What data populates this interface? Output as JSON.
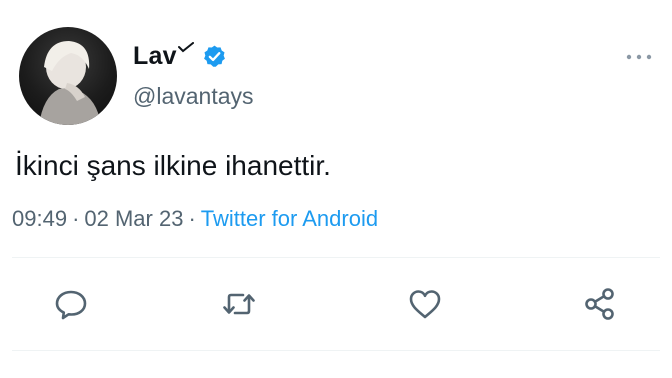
{
  "profile": {
    "display_name": "Lav",
    "name_emoji": "✓",
    "handle": "@lavantays",
    "verified": true,
    "avatar_icon": "profile-photo"
  },
  "tweet": {
    "text": "İkinci şans ilkine ihanettir.",
    "time": "09:49",
    "separator": "·",
    "date": "02 Mar 23",
    "source": "Twitter for Android"
  },
  "actions": [
    {
      "name": "reply",
      "icon": "comment-bubble-icon"
    },
    {
      "name": "retweet",
      "icon": "retweet-arrows-icon"
    },
    {
      "name": "like",
      "icon": "heart-icon"
    },
    {
      "name": "share",
      "icon": "share-nodes-icon"
    }
  ],
  "colors": {
    "accent": "#1d9bf0",
    "text_primary": "#0f1419",
    "text_secondary": "#536471",
    "icon": "#536471",
    "divider": "#eff3f4"
  }
}
